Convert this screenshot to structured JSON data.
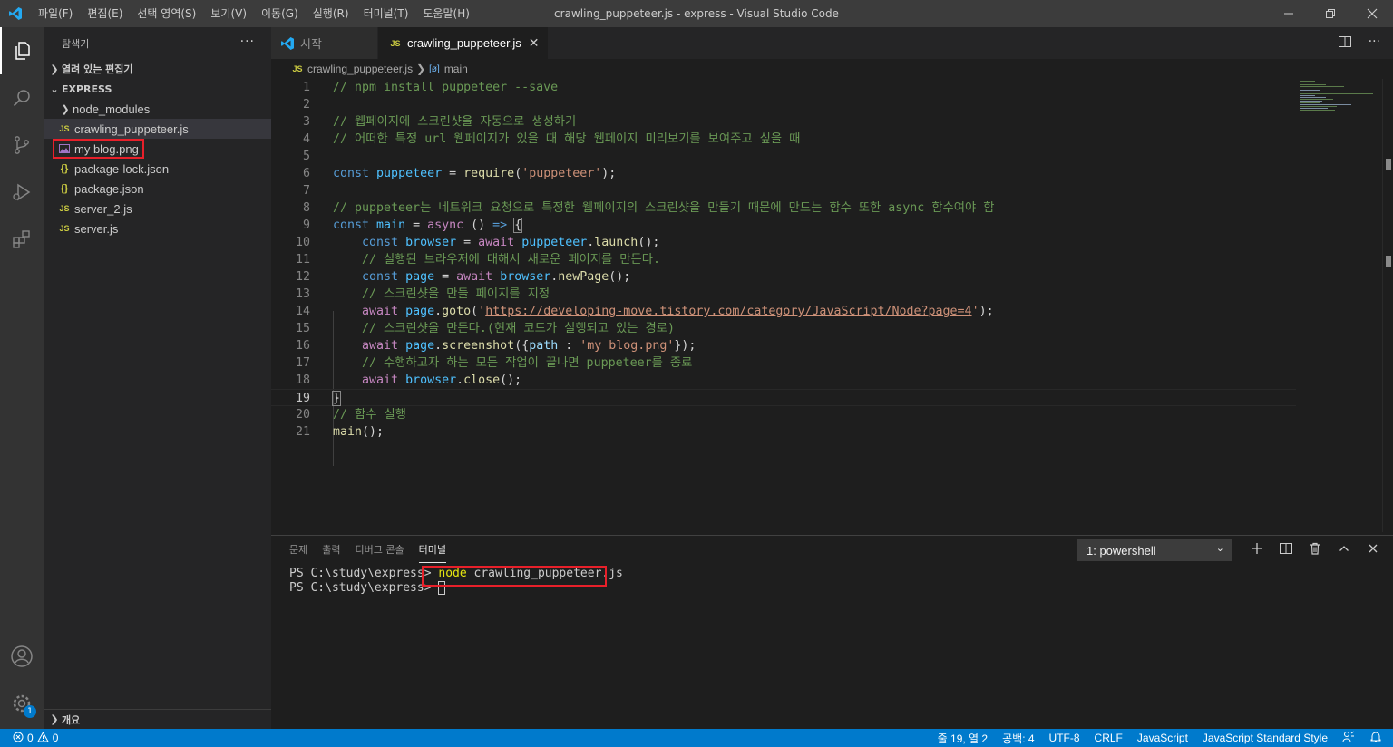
{
  "titlebar": {
    "window_title": "crawling_puppeteer.js - express - Visual Studio Code",
    "menu": [
      "파일(F)",
      "편집(E)",
      "선택 영역(S)",
      "보기(V)",
      "이동(G)",
      "실행(R)",
      "터미널(T)",
      "도움말(H)"
    ]
  },
  "sidebar": {
    "title": "탐색기",
    "more": "···",
    "open_editors": "열려 있는 편집기",
    "project": "EXPRESS",
    "files": [
      {
        "name": "node_modules",
        "icon": "chevron-right-icon"
      },
      {
        "name": "crawling_puppeteer.js",
        "icon": "JS"
      },
      {
        "name": "my blog.png",
        "icon": "image-icon"
      },
      {
        "name": "package-lock.json",
        "icon": "{}"
      },
      {
        "name": "package.json",
        "icon": "{}"
      },
      {
        "name": "server_2.js",
        "icon": "JS"
      },
      {
        "name": "server.js",
        "icon": "JS"
      }
    ],
    "outline": "개요"
  },
  "tabs": [
    {
      "label": "시작",
      "icon": "vscode-icon"
    },
    {
      "label": "crawling_puppeteer.js",
      "icon": "JS"
    }
  ],
  "breadcrumb": {
    "file": "crawling_puppeteer.js",
    "symbol": "main",
    "file_icon": "JS",
    "symbol_icon": "[ø]"
  },
  "editor": {
    "line_numbers": [
      "1",
      "2",
      "3",
      "4",
      "5",
      "6",
      "7",
      "8",
      "9",
      "10",
      "11",
      "12",
      "13",
      "14",
      "15",
      "16",
      "17",
      "18",
      "19",
      "20",
      "21"
    ],
    "lines": [
      "// npm install puppeteer --save",
      "",
      "// 웹페이지에 스크린샷을 자동으로 생성하기",
      "// 어떠한 특정 url 웹페이지가 있을 때 해당 웹페이지 미리보기를 보여주고 싶을 때",
      "",
      "const puppeteer = require('puppeteer');",
      "",
      "// puppeteer는 네트워크 요청으로 특정한 웹페이지의 스크린샷을 만들기 때문에 만드는 함수 또한 async 함수여야 함",
      "const main = async () => {",
      "    const browser = await puppeteer.launch();",
      "    // 실행된 브라우저에 대해서 새로운 페이지를 만든다.",
      "    const page = await browser.newPage();",
      "    // 스크린샷을 만들 페이지를 지정",
      "    await page.goto('https://developing-move.tistory.com/category/JavaScript/Node?page=4');",
      "    // 스크린샷을 만든다.(현재 코드가 실행되고 있는 경로)",
      "    await page.screenshot({path : 'my blog.png'});",
      "    // 수행하고자 하는 모든 작업이 끝나면 puppeteer를 종료",
      "    await browser.close();",
      "}",
      "// 함수 실행",
      "main();"
    ]
  },
  "panel": {
    "tabs": [
      "문제",
      "출력",
      "디버그 콘솔",
      "터미널"
    ],
    "terminal_select": "1: powershell",
    "prompt1": "PS C:\\study\\express> ",
    "command": "node crawling_puppeteer.js",
    "prompt2": "PS C:\\study\\express> "
  },
  "statusbar": {
    "errors": "0",
    "warnings": "0",
    "position": "줄 19, 열 2",
    "spaces": "공백: 4",
    "encoding": "UTF-8",
    "eol": "CRLF",
    "language": "JavaScript",
    "linter": "JavaScript Standard Style"
  },
  "colors": {
    "accent": "#007acc",
    "highlight_box": "#e8202a"
  },
  "settings_badge": "1"
}
